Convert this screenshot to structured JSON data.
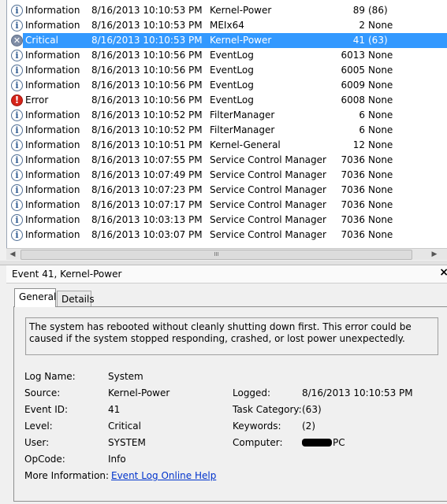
{
  "events": [
    {
      "level": "Information",
      "date": "8/16/2013 10:10:53 PM",
      "source": "Kernel-Power",
      "event_id": "89",
      "task": "(86)",
      "icon": "info-icon"
    },
    {
      "level": "Information",
      "date": "8/16/2013 10:10:53 PM",
      "source": "MEIx64",
      "event_id": "2",
      "task": "None",
      "icon": "info-icon"
    },
    {
      "level": "Critical",
      "date": "8/16/2013 10:10:53 PM",
      "source": "Kernel-Power",
      "event_id": "41",
      "task": "(63)",
      "icon": "critical-icon",
      "selected": true
    },
    {
      "level": "Information",
      "date": "8/16/2013 10:10:56 PM",
      "source": "EventLog",
      "event_id": "6013",
      "task": "None",
      "icon": "info-icon"
    },
    {
      "level": "Information",
      "date": "8/16/2013 10:10:56 PM",
      "source": "EventLog",
      "event_id": "6005",
      "task": "None",
      "icon": "info-icon"
    },
    {
      "level": "Information",
      "date": "8/16/2013 10:10:56 PM",
      "source": "EventLog",
      "event_id": "6009",
      "task": "None",
      "icon": "info-icon"
    },
    {
      "level": "Error",
      "date": "8/16/2013 10:10:56 PM",
      "source": "EventLog",
      "event_id": "6008",
      "task": "None",
      "icon": "error-icon"
    },
    {
      "level": "Information",
      "date": "8/16/2013 10:10:52 PM",
      "source": "FilterManager",
      "event_id": "6",
      "task": "None",
      "icon": "info-icon"
    },
    {
      "level": "Information",
      "date": "8/16/2013 10:10:52 PM",
      "source": "FilterManager",
      "event_id": "6",
      "task": "None",
      "icon": "info-icon"
    },
    {
      "level": "Information",
      "date": "8/16/2013 10:10:51 PM",
      "source": "Kernel-General",
      "event_id": "12",
      "task": "None",
      "icon": "info-icon"
    },
    {
      "level": "Information",
      "date": "8/16/2013 10:07:55 PM",
      "source": "Service Control Manager",
      "event_id": "7036",
      "task": "None",
      "icon": "info-icon"
    },
    {
      "level": "Information",
      "date": "8/16/2013 10:07:49 PM",
      "source": "Service Control Manager",
      "event_id": "7036",
      "task": "None",
      "icon": "info-icon"
    },
    {
      "level": "Information",
      "date": "8/16/2013 10:07:23 PM",
      "source": "Service Control Manager",
      "event_id": "7036",
      "task": "None",
      "icon": "info-icon"
    },
    {
      "level": "Information",
      "date": "8/16/2013 10:07:17 PM",
      "source": "Service Control Manager",
      "event_id": "7036",
      "task": "None",
      "icon": "info-icon"
    },
    {
      "level": "Information",
      "date": "8/16/2013 10:03:13 PM",
      "source": "Service Control Manager",
      "event_id": "7036",
      "task": "None",
      "icon": "info-icon"
    },
    {
      "level": "Information",
      "date": "8/16/2013 10:03:07 PM",
      "source": "Service Control Manager",
      "event_id": "7036",
      "task": "None",
      "icon": "info-icon"
    }
  ],
  "scrollbar": {
    "left_arrow": "◀",
    "right_arrow": "▶",
    "grip": "III"
  },
  "detail": {
    "title": "Event 41, Kernel-Power",
    "close": "×",
    "tabs": {
      "general": "General",
      "details": "Details"
    },
    "message": "The system has rebooted without cleanly shutting down first. This error could be caused if the system stopped responding, crashed, or lost power unexpectedly.",
    "labels": {
      "log_name": "Log Name:",
      "source": "Source:",
      "event_id": "Event ID:",
      "level": "Level:",
      "user": "User:",
      "opcode": "OpCode:",
      "more_info": "More Information:",
      "logged": "Logged:",
      "task_category": "Task Category:",
      "keywords": "Keywords:",
      "computer": "Computer:"
    },
    "values": {
      "log_name": "System",
      "source": "Kernel-Power",
      "event_id": "41",
      "level": "Critical",
      "user": "SYSTEM",
      "opcode": "Info",
      "more_info_link": "Event Log Online Help",
      "logged": "8/16/2013 10:10:53 PM",
      "task_category": "(63)",
      "keywords": "(2)",
      "computer_suffix": "PC"
    }
  }
}
